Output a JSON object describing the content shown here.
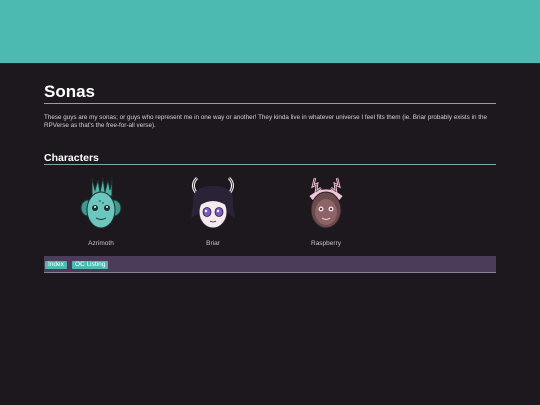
{
  "page": {
    "title": "Sonas",
    "intro": "These guys are my sonas; or guys who represent me in one way or another! They kinda live in whatever universe I feel fits them (ie. Briar probably exists in the RPVerse as that's the free-for-all verse).",
    "section_title": "Characters"
  },
  "characters": [
    {
      "name": "Azrimoth"
    },
    {
      "name": "Briar"
    },
    {
      "name": "Raspberry"
    }
  ],
  "nav": {
    "links": [
      {
        "label": "Index"
      },
      {
        "label": "OC Listing"
      }
    ]
  },
  "colors": {
    "accent": "#4dbab2",
    "background": "#1d181d",
    "navbar": "#4b3d5a"
  }
}
